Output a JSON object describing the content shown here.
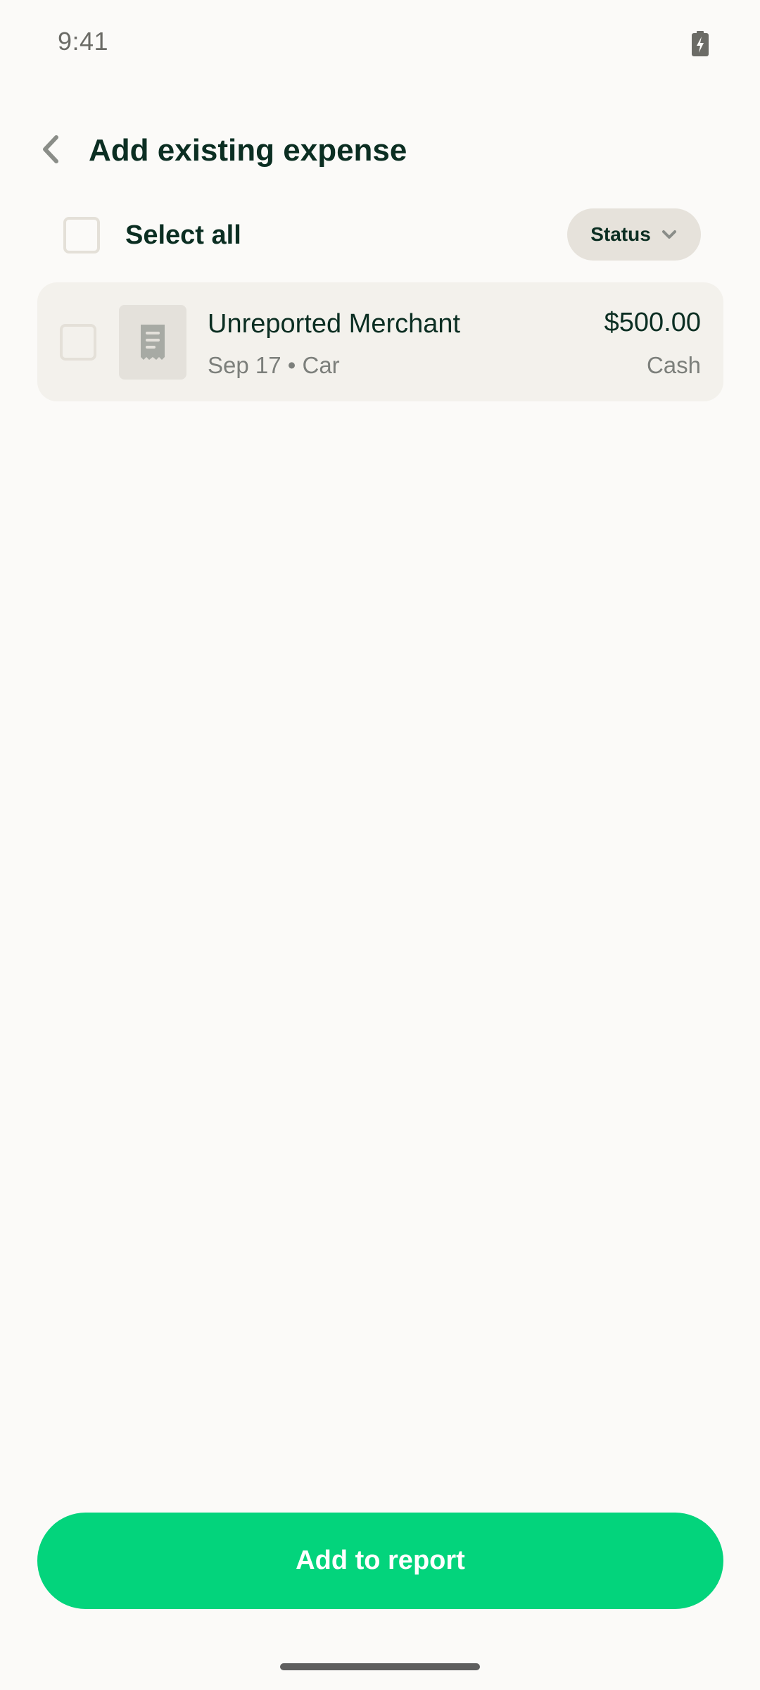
{
  "status_bar": {
    "time": "9:41",
    "battery_icon": "battery-charging-icon"
  },
  "header": {
    "back_icon": "chevron-left-icon",
    "title": "Add existing expense"
  },
  "toolbar": {
    "select_all_label": "Select all",
    "select_all_checked": false,
    "status_filter_label": "Status",
    "status_filter_icon": "chevron-down-icon"
  },
  "expenses": [
    {
      "checked": false,
      "receipt_icon": "receipt-icon",
      "merchant": "Unreported Merchant",
      "meta": "Sep 17 • Car",
      "amount": "$500.00",
      "payment_type": "Cash"
    }
  ],
  "footer": {
    "primary_button_label": "Add to report"
  },
  "colors": {
    "background": "#FBFAF8",
    "text_primary": "#0B2E22",
    "text_secondary": "#7C7F7B",
    "row_background": "#F3F1EC",
    "chip_background": "#E6E2DB",
    "checkbox_border": "#E4E0D8",
    "accent_green": "#03D47C"
  }
}
